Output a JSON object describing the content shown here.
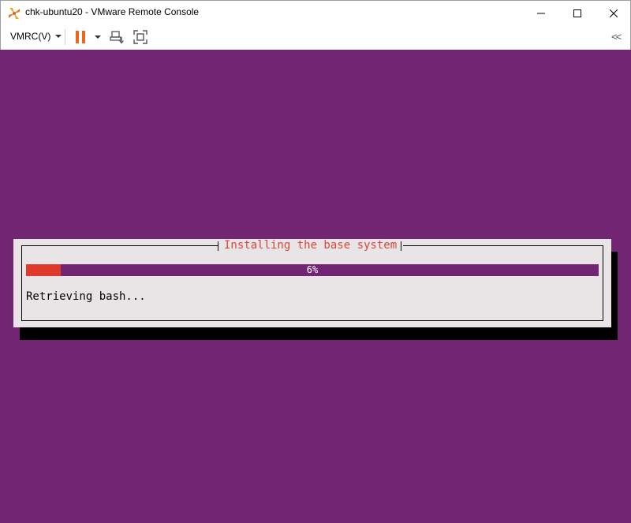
{
  "window": {
    "title": "chk-ubuntu20 - VMware Remote Console",
    "app_icon": "vmware-pinwheel-icon",
    "controls": [
      "minimize-icon",
      "maximize-icon",
      "close-icon"
    ]
  },
  "toolbar": {
    "menu_label": "VMRC(V)",
    "buttons": [
      "pause-icon",
      "send-ctrl-alt-del-icon",
      "fullscreen-icon",
      "collapse-icon"
    ],
    "collapse_label": "<<"
  },
  "installer": {
    "dialog_title": "Installing the base system",
    "progress_percent": 6,
    "progress_label": "6%",
    "status": "Retrieving bash..."
  },
  "colors": {
    "console_bg": "#722573",
    "dialog_bg": "#e9e5e7",
    "progress_fill": "#dd3a2c",
    "title_text": "#d9463a",
    "pause_accent": "#f0641e"
  }
}
